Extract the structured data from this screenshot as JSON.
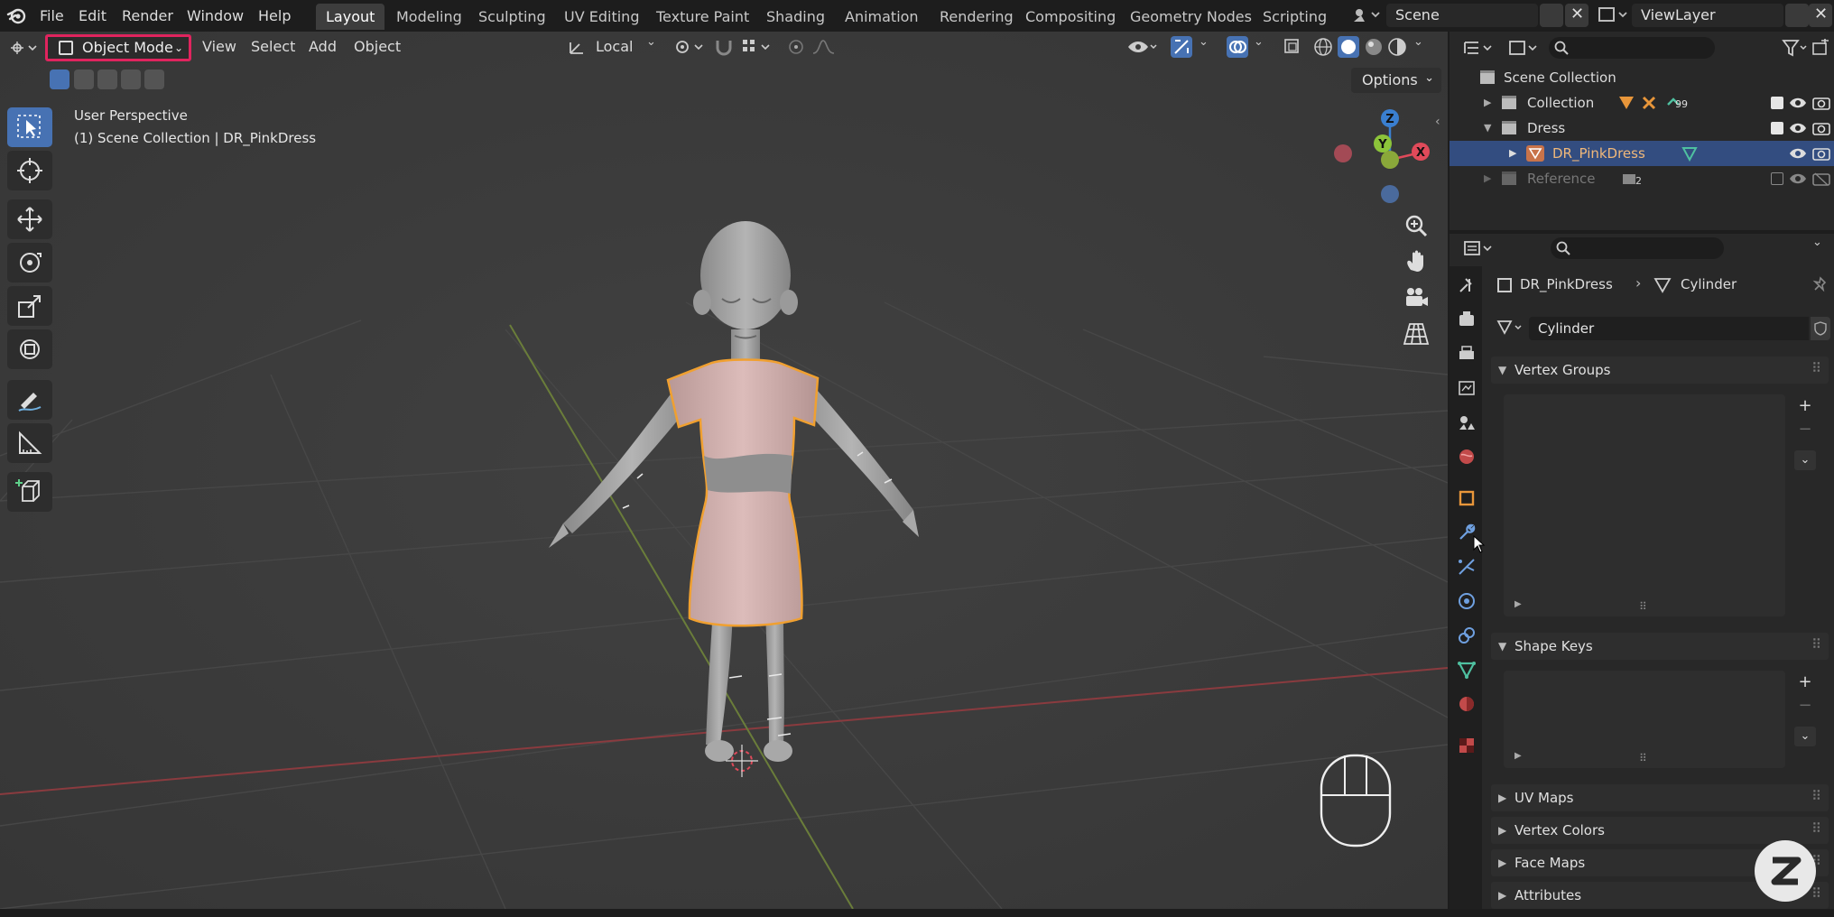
{
  "menubar": {
    "file": "File",
    "edit": "Edit",
    "render": "Render",
    "window": "Window",
    "help": "Help"
  },
  "workspaces": [
    "Layout",
    "Modeling",
    "Sculpting",
    "UV Editing",
    "Texture Paint",
    "Shading",
    "Animation",
    "Rendering",
    "Compositing",
    "Geometry Nodes",
    "Scripting"
  ],
  "active_workspace": "Layout",
  "scene": {
    "name": "Scene",
    "view_layer": "ViewLayer"
  },
  "viewport_header": {
    "mode": "Object Mode",
    "view": "View",
    "select": "Select",
    "add": "Add",
    "object": "Object",
    "transform_orientation": "Local",
    "options": "Options"
  },
  "viewport_info": {
    "perspective": "User Perspective",
    "context": "(1) Scene Collection | DR_PinkDress"
  },
  "gizmo": {
    "z": "Z",
    "y": "Y",
    "x": "X"
  },
  "outliner": {
    "root": "Scene Collection",
    "rows": [
      {
        "name": "Collection",
        "badge": "99"
      },
      {
        "name": "Dress"
      },
      {
        "name": "DR_PinkDress"
      },
      {
        "name": "Reference",
        "badge": "2"
      }
    ]
  },
  "properties": {
    "object_name": "DR_PinkDress",
    "data_name": "Cylinder",
    "datablock_field": "Cylinder",
    "panels": {
      "vertex_groups": "Vertex Groups",
      "shape_keys": "Shape Keys",
      "uv_maps": "UV Maps",
      "vertex_colors": "Vertex Colors",
      "face_maps": "Face Maps",
      "attributes": "Attributes"
    }
  },
  "colors": {
    "accent_blue": "#4772b3",
    "mode_highlight": "#e0245e",
    "selection_orange": "#f0a030",
    "axis_x": "#e04a5a",
    "axis_y": "#8cc43a",
    "axis_z": "#3a7fd0",
    "dress_pink": "#d8b4b2"
  }
}
